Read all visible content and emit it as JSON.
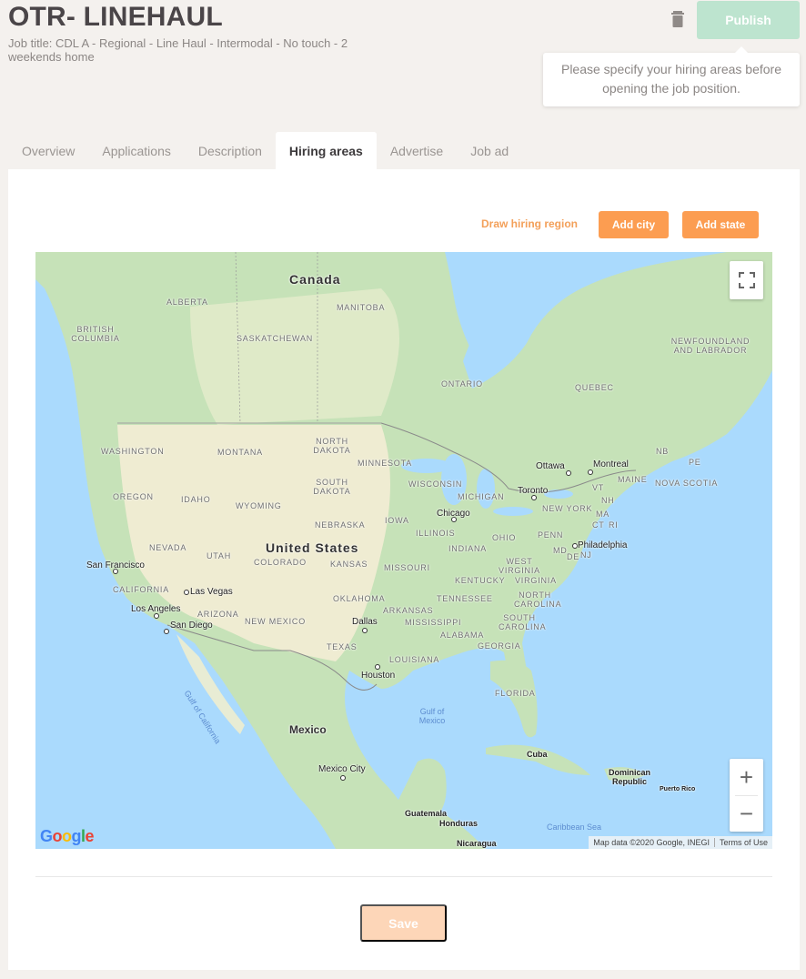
{
  "header": {
    "title": "OTR- LINEHAUL",
    "subtitle": "Job title: CDL A - Regional - Line Haul - Intermodal - No touch - 2 weekends home",
    "publish_label": "Publish",
    "tooltip": "Please specify your hiring areas before opening the job position."
  },
  "tabs": [
    {
      "label": "Overview",
      "active": false
    },
    {
      "label": "Applications",
      "active": false
    },
    {
      "label": "Description",
      "active": false
    },
    {
      "label": "Hiring areas",
      "active": true
    },
    {
      "label": "Advertise",
      "active": false
    },
    {
      "label": "Job ad",
      "active": false
    }
  ],
  "actions": {
    "draw_region": "Draw hiring region",
    "add_city": "Add city",
    "add_state": "Add state"
  },
  "map": {
    "countries": [
      "Canada",
      "United States",
      "Mexico"
    ],
    "provinces": [
      "ALBERTA",
      "BRITISH COLUMBIA",
      "SASKATCHEWAN",
      "MANITOBA",
      "ONTARIO",
      "QUEBEC",
      "NEWFOUNDLAND AND LABRADOR",
      "NB",
      "PE",
      "NOVA SCOTIA"
    ],
    "states": [
      "WASHINGTON",
      "OREGON",
      "CALIFORNIA",
      "NEVADA",
      "IDAHO",
      "MONTANA",
      "WYOMING",
      "UTAH",
      "ARIZONA",
      "COLORADO",
      "NEW MEXICO",
      "NORTH DAKOTA",
      "SOUTH DAKOTA",
      "NEBRASKA",
      "KANSAS",
      "OKLAHOMA",
      "TEXAS",
      "MINNESOTA",
      "IOWA",
      "MISSOURI",
      "ARKANSAS",
      "LOUISIANA",
      "WISCONSIN",
      "ILLINOIS",
      "MICHIGAN",
      "INDIANA",
      "OHIO",
      "KENTUCKY",
      "TENNESSEE",
      "MISSISSIPPI",
      "ALABAMA",
      "GEORGIA",
      "FLORIDA",
      "SOUTH CAROLINA",
      "NORTH CAROLINA",
      "VIRGINIA",
      "WEST VIRGINIA",
      "PENN",
      "NEW YORK",
      "VT",
      "NH",
      "MA",
      "CT",
      "RI",
      "MAINE",
      "MD",
      "DE",
      "NJ"
    ],
    "cities": [
      "San Francisco",
      "Los Angeles",
      "San Diego",
      "Las Vegas",
      "Dallas",
      "Houston",
      "Chicago",
      "Toronto",
      "Ottawa",
      "Montreal",
      "Philadelphia",
      "Mexico City"
    ],
    "other": [
      "Cuba",
      "Dominican Republic",
      "Puerto Rico",
      "Guatemala",
      "Honduras",
      "Nicaragua"
    ],
    "water": [
      "Gulf of Mexico",
      "Gulf of California",
      "Caribbean Sea"
    ],
    "logo": "Google",
    "attribution": "Map data ©2020 Google, INEGI",
    "terms": "Terms of Use",
    "zoom_in": "+",
    "zoom_out": "−"
  },
  "footer": {
    "save_label": "Save"
  },
  "colors": {
    "accent": "#fc9d51",
    "publish_disabled": "#bde4cf",
    "save_disabled": "#fdd6b8",
    "water": "#aadafd",
    "land": "#e8ecd4"
  }
}
